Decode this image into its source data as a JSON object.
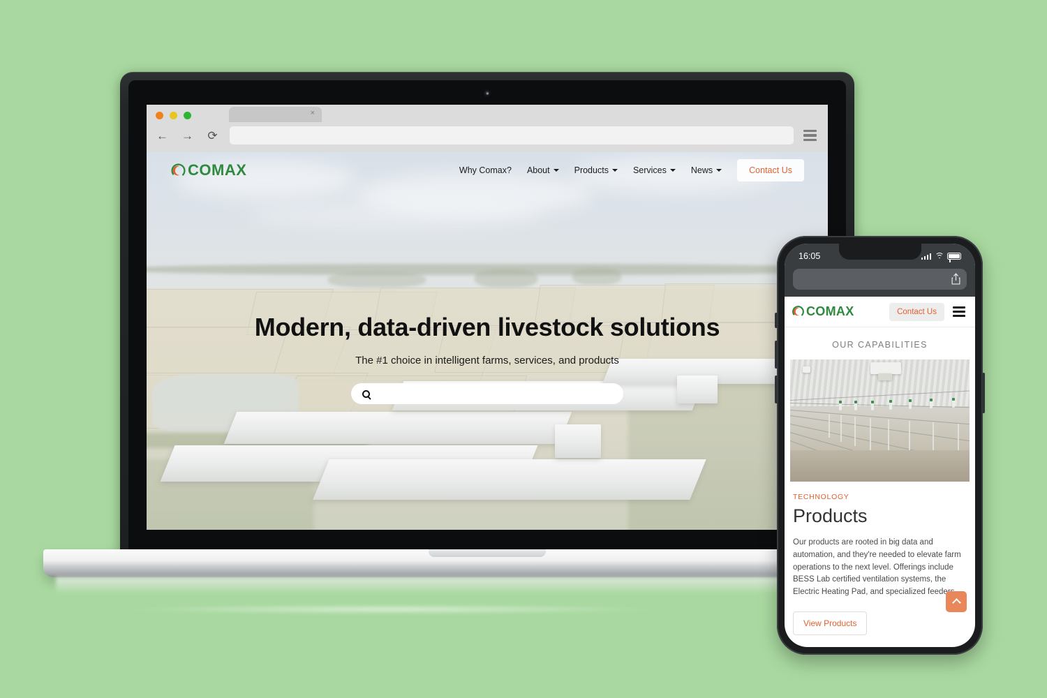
{
  "background_color": "#a9d9a0",
  "brand": {
    "name": "COMAX",
    "green": "#2f8a3e",
    "orange": "#e2602f"
  },
  "laptop": {
    "browser": {
      "tab_close_label": "×",
      "back_icon": "←",
      "forward_icon": "→",
      "reload_icon": "⟳",
      "url_value": "",
      "url_placeholder": ""
    },
    "site": {
      "logo_text": "COMAX",
      "nav_items": [
        {
          "label": "Why Comax?",
          "has_dropdown": false
        },
        {
          "label": "About",
          "has_dropdown": true
        },
        {
          "label": "Products",
          "has_dropdown": true
        },
        {
          "label": "Services",
          "has_dropdown": true
        },
        {
          "label": "News",
          "has_dropdown": true
        }
      ],
      "contact_label": "Contact Us",
      "hero_title": "Modern, data-driven livestock solutions",
      "hero_subtitle": "The #1 choice in intelligent farms, services, and products",
      "search_value": "",
      "search_placeholder": ""
    }
  },
  "phone": {
    "status": {
      "time": "16:05",
      "signal": "signal-icon",
      "wifi": "wifi-icon",
      "battery": "battery-icon"
    },
    "browser": {
      "url_value": "",
      "share_icon": "share-icon"
    },
    "site": {
      "logo_text": "COMAX",
      "contact_label": "Contact Us",
      "section_label": "OUR CAPABILITIES",
      "tag": "TECHNOLOGY",
      "title": "Products",
      "body": "Our products are rooted in big data and automation, and they're needed to elevate farm operations to the next level. Offerings include BESS Lab certified ventilation systems, the Electric Heating Pad, and specialized feeders.",
      "cta_label": "View Products",
      "scroll_top_icon": "chevron-up-icon"
    }
  }
}
